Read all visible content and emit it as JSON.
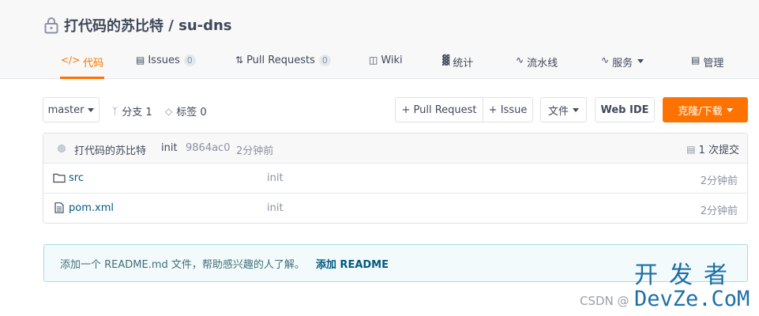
{
  "repo": {
    "owner": "打代码的苏比特",
    "separator": " / ",
    "name": "su-dns"
  },
  "nav": {
    "code": "代码",
    "issues": "Issues",
    "issues_count": "0",
    "pulls": "Pull Requests",
    "pulls_count": "0",
    "wiki": "Wiki",
    "stats": "统计",
    "pipeline": "流水线",
    "services": "服务",
    "manage": "管理"
  },
  "toolbar": {
    "branch": "master",
    "branches": "分支 1",
    "tags": "标签 0",
    "new_pr": "+ Pull Request",
    "new_issue": "+ Issue",
    "file_menu": "文件",
    "web_ide": "Web IDE",
    "clone": "克隆/下载"
  },
  "commit": {
    "author": "打代码的苏比特",
    "message": "init",
    "sha": "9864ac0",
    "time": "2分钟前",
    "count": "1 次提交"
  },
  "files": [
    {
      "name": "src",
      "type": "folder",
      "message": "init",
      "time": "2分钟前"
    },
    {
      "name": "pom.xml",
      "type": "file",
      "message": "init",
      "time": "2分钟前"
    }
  ],
  "readme": {
    "prompt": "添加一个 README.md 文件，帮助感兴趣的人了解。",
    "action": "添加 README"
  },
  "watermark": {
    "csdn": "CSDN @",
    "logo_top": "开发者",
    "logo_bottom": "DevZe.CoM"
  },
  "colors": {
    "accent": "#fe7300",
    "link": "#005980",
    "info_border": "#a6dbe4"
  }
}
